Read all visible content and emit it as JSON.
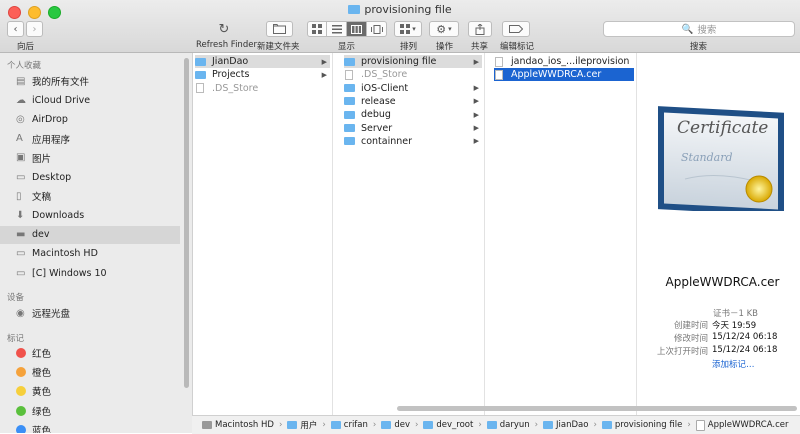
{
  "window": {
    "title": "provisioning file"
  },
  "toolbar": {
    "back_label": "向后",
    "refresh_label": "Refresh Finder",
    "new_folder_label": "新建文件夹",
    "display_label": "显示",
    "arrange_label": "排列",
    "action_label": "操作",
    "share_label": "共享",
    "tags_label": "编辑标记",
    "search_label": "搜索",
    "search_placeholder": "搜索"
  },
  "sidebar": {
    "favorites_header": "个人收藏",
    "favorites": [
      {
        "label": "我的所有文件",
        "icon": "all-files-icon"
      },
      {
        "label": "iCloud Drive",
        "icon": "cloud-icon"
      },
      {
        "label": "AirDrop",
        "icon": "airdrop-icon"
      },
      {
        "label": "应用程序",
        "icon": "applications-icon"
      },
      {
        "label": "图片",
        "icon": "camera-icon"
      },
      {
        "label": "Desktop",
        "icon": "desktop-icon"
      },
      {
        "label": "文稿",
        "icon": "document-icon"
      },
      {
        "label": "Downloads",
        "icon": "download-icon"
      },
      {
        "label": "dev",
        "icon": "folder-icon"
      },
      {
        "label": "Macintosh HD",
        "icon": "harddisk-icon"
      },
      {
        "label": "[C] Windows 10",
        "icon": "harddisk-icon"
      }
    ],
    "devices_header": "设备",
    "devices": [
      {
        "label": "远程光盘",
        "icon": "disc-icon"
      }
    ],
    "tags_header": "标记",
    "tags": [
      {
        "label": "红色",
        "color": "#f0524b"
      },
      {
        "label": "橙色",
        "color": "#f5a23b"
      },
      {
        "label": "黄色",
        "color": "#f6cf3b"
      },
      {
        "label": "绿色",
        "color": "#5ac03c"
      },
      {
        "label": "蓝色",
        "color": "#3b8ff6"
      }
    ]
  },
  "columns": {
    "col1": [
      {
        "label": "JianDao",
        "type": "folder",
        "selected": true,
        "arrow": true
      },
      {
        "label": "Projects",
        "type": "folder",
        "arrow": true
      },
      {
        "label": ".DS_Store",
        "type": "file",
        "gray": true
      }
    ],
    "col2": [
      {
        "label": "provisioning file",
        "type": "folder",
        "selected": true,
        "arrow": true
      },
      {
        "label": ".DS_Store",
        "type": "file",
        "gray": true
      },
      {
        "label": "iOS-Client",
        "type": "folder",
        "arrow": true
      },
      {
        "label": "release",
        "type": "folder",
        "arrow": true
      },
      {
        "label": "debug",
        "type": "folder",
        "arrow": true
      },
      {
        "label": "Server",
        "type": "folder",
        "arrow": true
      },
      {
        "label": "containner",
        "type": "folder",
        "arrow": true
      }
    ],
    "col3": [
      {
        "label": "jandao_ios_...ileprovision",
        "type": "file"
      },
      {
        "label": "AppleWWDRCA.cer",
        "type": "file",
        "active": true
      }
    ]
  },
  "preview": {
    "filename": "AppleWWDRCA.cer",
    "cert_title": "Certificate",
    "cert_subtitle": "Standard",
    "kind_size": "证书－1 KB",
    "rows": [
      {
        "label": "创建时间",
        "value": "今天 19:59"
      },
      {
        "label": "修改时间",
        "value": "15/12/24 06:18"
      },
      {
        "label": "上次打开时间",
        "value": "15/12/24 06:18"
      }
    ],
    "add_tags": "添加标记…"
  },
  "pathbar": [
    "Macintosh HD",
    "用户",
    "crifan",
    "dev",
    "dev_root",
    "daryun",
    "JianDao",
    "provisioning file",
    "AppleWWDRCA.cer"
  ],
  "colors": {
    "selection": "#1b64d1",
    "folder": "#6ab5ef",
    "link": "#1b64d1"
  }
}
